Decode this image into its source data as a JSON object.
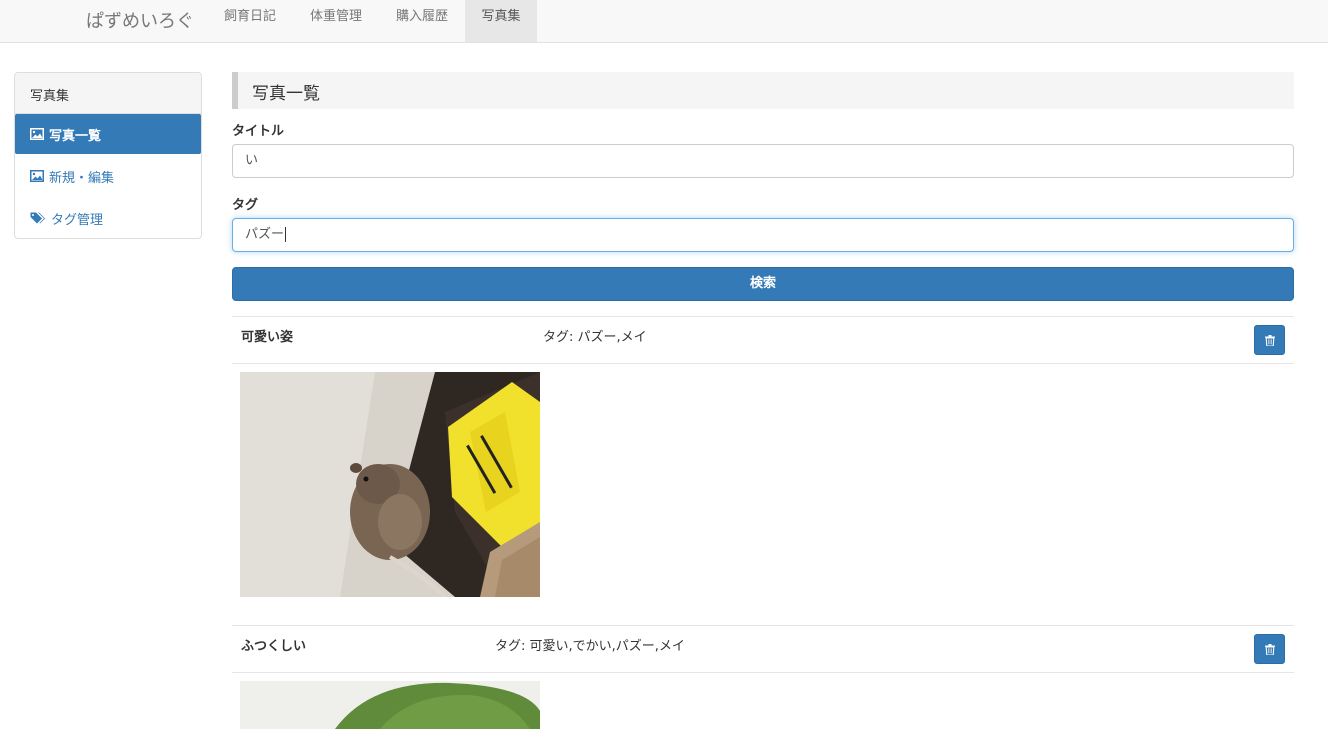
{
  "navbar": {
    "brand": "ぱずめいろぐ",
    "items": [
      {
        "label": "飼育日記",
        "active": false
      },
      {
        "label": "体重管理",
        "active": false
      },
      {
        "label": "購入履歴",
        "active": false
      },
      {
        "label": "写真集",
        "active": true
      }
    ]
  },
  "sidebar": {
    "heading": "写真集",
    "items": [
      {
        "label": "写真一覧",
        "icon": "picture-icon",
        "active": true
      },
      {
        "label": "新規・編集",
        "icon": "picture-icon",
        "active": false
      },
      {
        "label": "タグ管理",
        "icon": "tags-icon",
        "active": false
      }
    ]
  },
  "main": {
    "header": "写真一覧",
    "title_label": "タイトル",
    "title_value": "い",
    "tag_label": "タグ",
    "tag_value": "パズー",
    "search_label": "検索"
  },
  "photos": [
    {
      "title": "可愛い姿",
      "tags_label": "タグ:",
      "tags": "パズー,メイ",
      "delete_icon": "trash-icon"
    },
    {
      "title": "ふつくしい",
      "tags_label": "タグ:",
      "tags": "可愛い,でかい,パズー,メイ",
      "delete_icon": "trash-icon"
    }
  ],
  "colors": {
    "primary": "#337ab7",
    "navbar_bg": "#f8f8f8",
    "active_nav_bg": "#e7e7e7",
    "focus_border": "#66afe9"
  }
}
